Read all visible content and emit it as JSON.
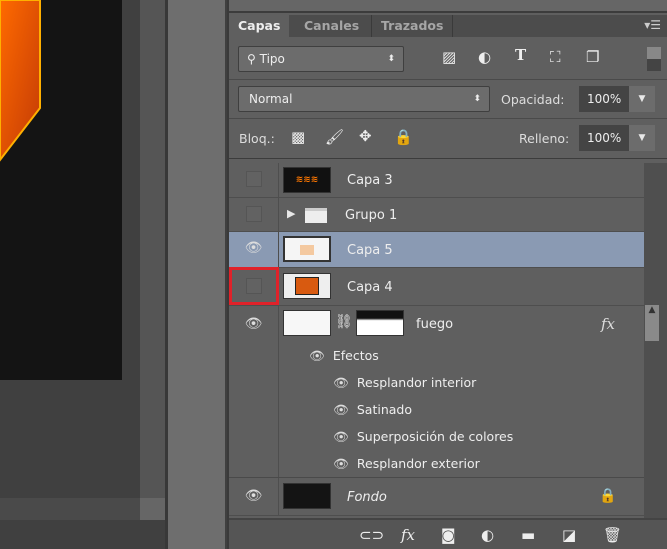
{
  "tabs": [
    {
      "label": "Capas",
      "active": true
    },
    {
      "label": "Canales",
      "active": false
    },
    {
      "label": "Trazados",
      "active": false
    }
  ],
  "panel_menu_icon": "panel-menu-icon",
  "filter": {
    "label": "Tipo",
    "icons": [
      "image-filter-icon",
      "adjustment-filter-icon",
      "type-filter-icon",
      "shape-filter-icon",
      "smart-object-filter-icon"
    ]
  },
  "blend": {
    "mode": "Normal",
    "opacity_label": "Opacidad:",
    "opacity": "100%"
  },
  "lock": {
    "label": "Bloq.:",
    "icons": [
      "lock-transparent-icon",
      "lock-paint-icon",
      "lock-move-icon",
      "lock-all-icon"
    ],
    "fill_label": "Relleno:",
    "fill": "100%"
  },
  "layers": [
    {
      "name": "Capa 3",
      "visible": false
    },
    {
      "name": "Grupo 1",
      "visible": false,
      "type": "group"
    },
    {
      "name": "Capa 5",
      "visible": true,
      "selected": true
    },
    {
      "name": "Capa 4",
      "visible": false,
      "highlighted": true
    },
    {
      "name": "fuego",
      "visible": true,
      "fx": "fx",
      "effects_label": "Efectos",
      "effects": [
        "Resplandor interior",
        "Satinado",
        "Superposición de colores",
        "Resplandor exterior"
      ]
    },
    {
      "name": "Fondo",
      "visible": true,
      "locked": true
    }
  ],
  "colors": {
    "selected": "#8a9ab3",
    "highlight": "#e0222a"
  },
  "bottom_icons": [
    "link-icon",
    "fx-icon",
    "mask-icon",
    "adjustment-icon",
    "folder-icon",
    "new-layer-icon",
    "trash-icon"
  ]
}
